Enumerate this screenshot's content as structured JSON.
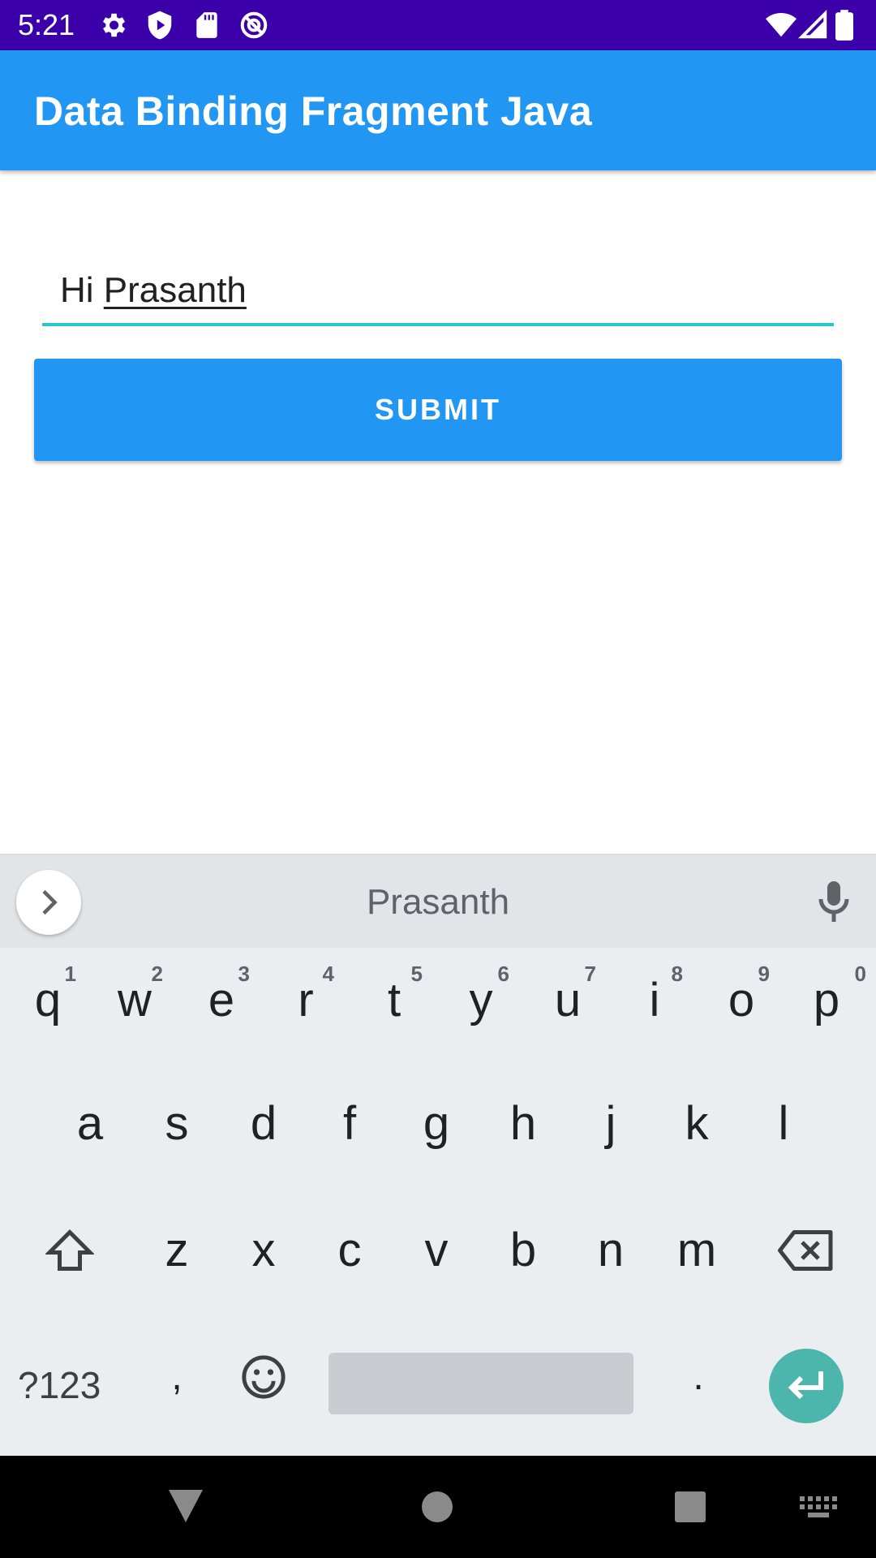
{
  "status_bar": {
    "time": "5:21",
    "icons": [
      "settings-icon",
      "play-protect-icon",
      "sd-card-icon",
      "do-not-disturb-icon",
      "wifi-icon",
      "signal-icon",
      "battery-icon"
    ]
  },
  "app_bar": {
    "title": "Data Binding Fragment Java"
  },
  "form": {
    "input_prefix": "Hi ",
    "input_composing": "Prasanth",
    "submit_label": "SUBMIT"
  },
  "keyboard": {
    "suggestion": "Prasanth",
    "row1": [
      {
        "label": "q",
        "hint": "1"
      },
      {
        "label": "w",
        "hint": "2"
      },
      {
        "label": "e",
        "hint": "3"
      },
      {
        "label": "r",
        "hint": "4"
      },
      {
        "label": "t",
        "hint": "5"
      },
      {
        "label": "y",
        "hint": "6"
      },
      {
        "label": "u",
        "hint": "7"
      },
      {
        "label": "i",
        "hint": "8"
      },
      {
        "label": "o",
        "hint": "9"
      },
      {
        "label": "p",
        "hint": "0"
      }
    ],
    "row2": [
      "a",
      "s",
      "d",
      "f",
      "g",
      "h",
      "j",
      "k",
      "l"
    ],
    "row3": [
      "z",
      "x",
      "c",
      "v",
      "b",
      "n",
      "m"
    ],
    "symbols_label": "?123",
    "comma_label": ",",
    "period_label": "."
  },
  "colors": {
    "status_bar": "#3c00ab",
    "app_bar": "#2196f3",
    "accent": "#26c6c9",
    "enter_key": "#4db6ac"
  }
}
